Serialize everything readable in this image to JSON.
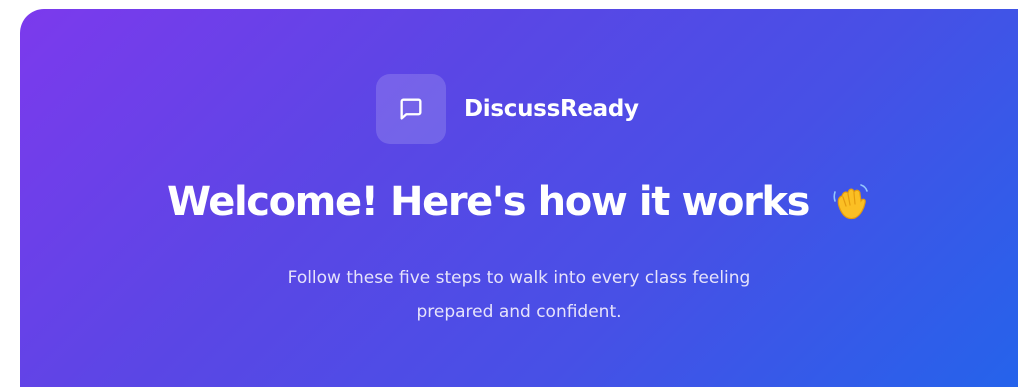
{
  "brand": {
    "name": "DiscussReady",
    "icon": "chat-bubble-icon"
  },
  "hero": {
    "title": "Welcome! Here's how it works",
    "emoji_icon": "waving-hand-icon",
    "subtitle_line1": "Follow these five steps to walk into every class feeling",
    "subtitle_line2": "prepared and confident."
  },
  "colors": {
    "gradient_start": "#7c3aed",
    "gradient_end": "#2563eb",
    "text": "#ffffff"
  }
}
